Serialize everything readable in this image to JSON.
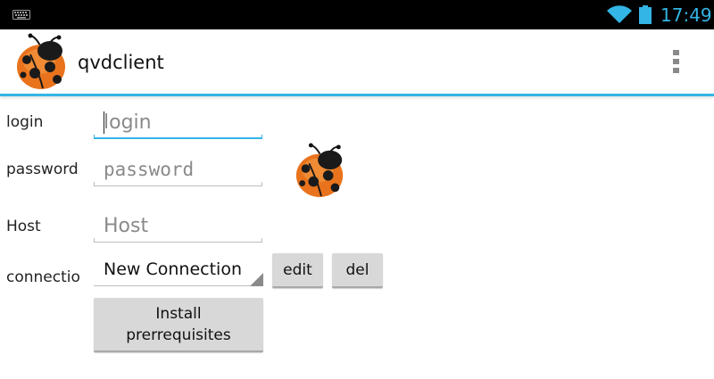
{
  "status_bar": {
    "time": "17:49",
    "icons": [
      "keyboard-icon",
      "wifi-icon",
      "battery-icon"
    ],
    "accent_color": "#33b5e5"
  },
  "action_bar": {
    "title": "qvdclient",
    "app_icon": "ladybug-icon",
    "menu_icon": "overflow-menu-icon",
    "accent_color": "#33b5e5"
  },
  "form": {
    "login": {
      "label": "login",
      "value": "",
      "placeholder": "login",
      "focused": true
    },
    "password": {
      "label": "password",
      "value": "",
      "placeholder": "password"
    },
    "host": {
      "label": "Host",
      "value": "",
      "placeholder": "Host"
    },
    "connection": {
      "label": "connectio",
      "selected": "New Connection"
    },
    "buttons": {
      "edit": "edit",
      "del": "del",
      "install_line1": "Install",
      "install_line2": "prerrequisites"
    },
    "side_icon": "ladybug-icon"
  }
}
